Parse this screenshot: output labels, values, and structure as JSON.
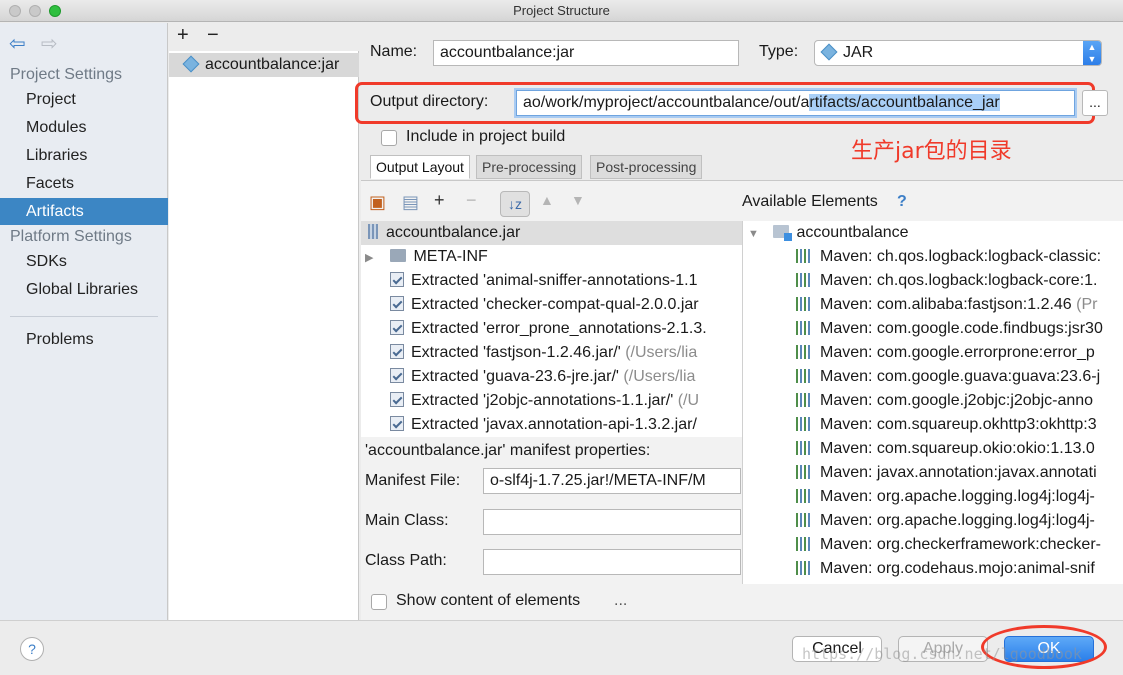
{
  "window": {
    "title": "Project Structure"
  },
  "sidebar": {
    "group_project_settings": "Project Settings",
    "project_items": [
      {
        "label": "Project"
      },
      {
        "label": "Modules"
      },
      {
        "label": "Libraries"
      },
      {
        "label": "Facets"
      },
      {
        "label": "Artifacts"
      }
    ],
    "group_platform_settings": "Platform Settings",
    "platform_items": [
      {
        "label": "SDKs"
      },
      {
        "label": "Global Libraries"
      }
    ],
    "problems": "Problems"
  },
  "artifacts": {
    "add": "+",
    "remove": "−",
    "selected": "accountbalance:jar"
  },
  "form": {
    "name_label": "Name:",
    "name_value": "accountbalance:jar",
    "type_label": "Type:",
    "type_value": "JAR",
    "output_label": "Output directory:",
    "output_value_plain": "ao/work/myproject/accountbalance/out/a",
    "output_value_selected": "rtifacts/accountbalance_jar",
    "browse_label": "...",
    "include_label": "Include in project build",
    "annotation": "生产jar包的目录"
  },
  "tabs": [
    {
      "label": "Output Layout"
    },
    {
      "label": "Pre-processing"
    },
    {
      "label": "Post-processing"
    }
  ],
  "layout_tree": {
    "root": "accountbalance.jar",
    "items": [
      {
        "text": "META-INF",
        "tail": ""
      },
      {
        "text": "Extracted 'animal-sniffer-annotations-1.1",
        "tail": ""
      },
      {
        "text": "Extracted 'checker-compat-qual-2.0.0.jar",
        "tail": ""
      },
      {
        "text": "Extracted 'error_prone_annotations-2.1.3.",
        "tail": ""
      },
      {
        "text": "Extracted 'fastjson-1.2.46.jar/'",
        "tail": " (/Users/lia"
      },
      {
        "text": "Extracted 'guava-23.6-jre.jar/'",
        "tail": " (/Users/lia"
      },
      {
        "text": "Extracted 'j2objc-annotations-1.1.jar/'",
        "tail": " (/U"
      },
      {
        "text": "Extracted 'javax.annotation-api-1.3.2.jar/",
        "tail": ""
      }
    ]
  },
  "manifest": {
    "header": "'accountbalance.jar' manifest properties:",
    "file_label": "Manifest File:",
    "file_value": "o-slf4j-1.7.25.jar!/META-INF/M",
    "main_class_label": "Main Class:",
    "main_class_value": "",
    "class_path_label": "Class Path:",
    "class_path_value": ""
  },
  "available": {
    "title": "Available Elements",
    "help": "?",
    "root": "accountbalance",
    "items": [
      {
        "text": "Maven: ch.qos.logback:logback-classic:",
        "tail": ""
      },
      {
        "text": "Maven: ch.qos.logback:logback-core:1.",
        "tail": ""
      },
      {
        "text": "Maven: com.alibaba:fastjson:1.2.46",
        "tail": " (Pr"
      },
      {
        "text": "Maven: com.google.code.findbugs:jsr30",
        "tail": ""
      },
      {
        "text": "Maven: com.google.errorprone:error_p",
        "tail": ""
      },
      {
        "text": "Maven: com.google.guava:guava:23.6-j",
        "tail": ""
      },
      {
        "text": "Maven: com.google.j2objc:j2objc-anno",
        "tail": ""
      },
      {
        "text": "Maven: com.squareup.okhttp3:okhttp:3",
        "tail": ""
      },
      {
        "text": "Maven: com.squareup.okio:okio:1.13.0",
        "tail": ""
      },
      {
        "text": "Maven: javax.annotation:javax.annotati",
        "tail": ""
      },
      {
        "text": "Maven: org.apache.logging.log4j:log4j-",
        "tail": ""
      },
      {
        "text": "Maven: org.apache.logging.log4j:log4j-",
        "tail": ""
      },
      {
        "text": "Maven: org.checkerframework:checker-",
        "tail": ""
      },
      {
        "text": "Maven: org.codehaus.mojo:animal-snif",
        "tail": ""
      }
    ]
  },
  "show_content_label": "Show content of elements",
  "show_content_more": "...",
  "footer": {
    "help": "?",
    "cancel": "Cancel",
    "apply": "Apply",
    "ok": "OK",
    "watermark": "https://blog.csdn.net/lgoodbook"
  },
  "colors": {
    "accent": "#3c86c4",
    "annotation_red": "#f03a2a",
    "primary_button": "#2a7fea"
  }
}
